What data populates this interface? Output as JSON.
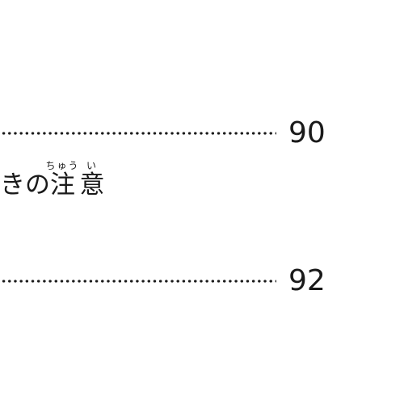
{
  "toc": {
    "rows": [
      {
        "page": "90"
      },
      {
        "page": "92"
      }
    ],
    "entry": {
      "prefix": "きの",
      "kanji_1": "注",
      "kanji_2": "意",
      "ruby_1": "ちゅう",
      "ruby_2": "い"
    }
  }
}
